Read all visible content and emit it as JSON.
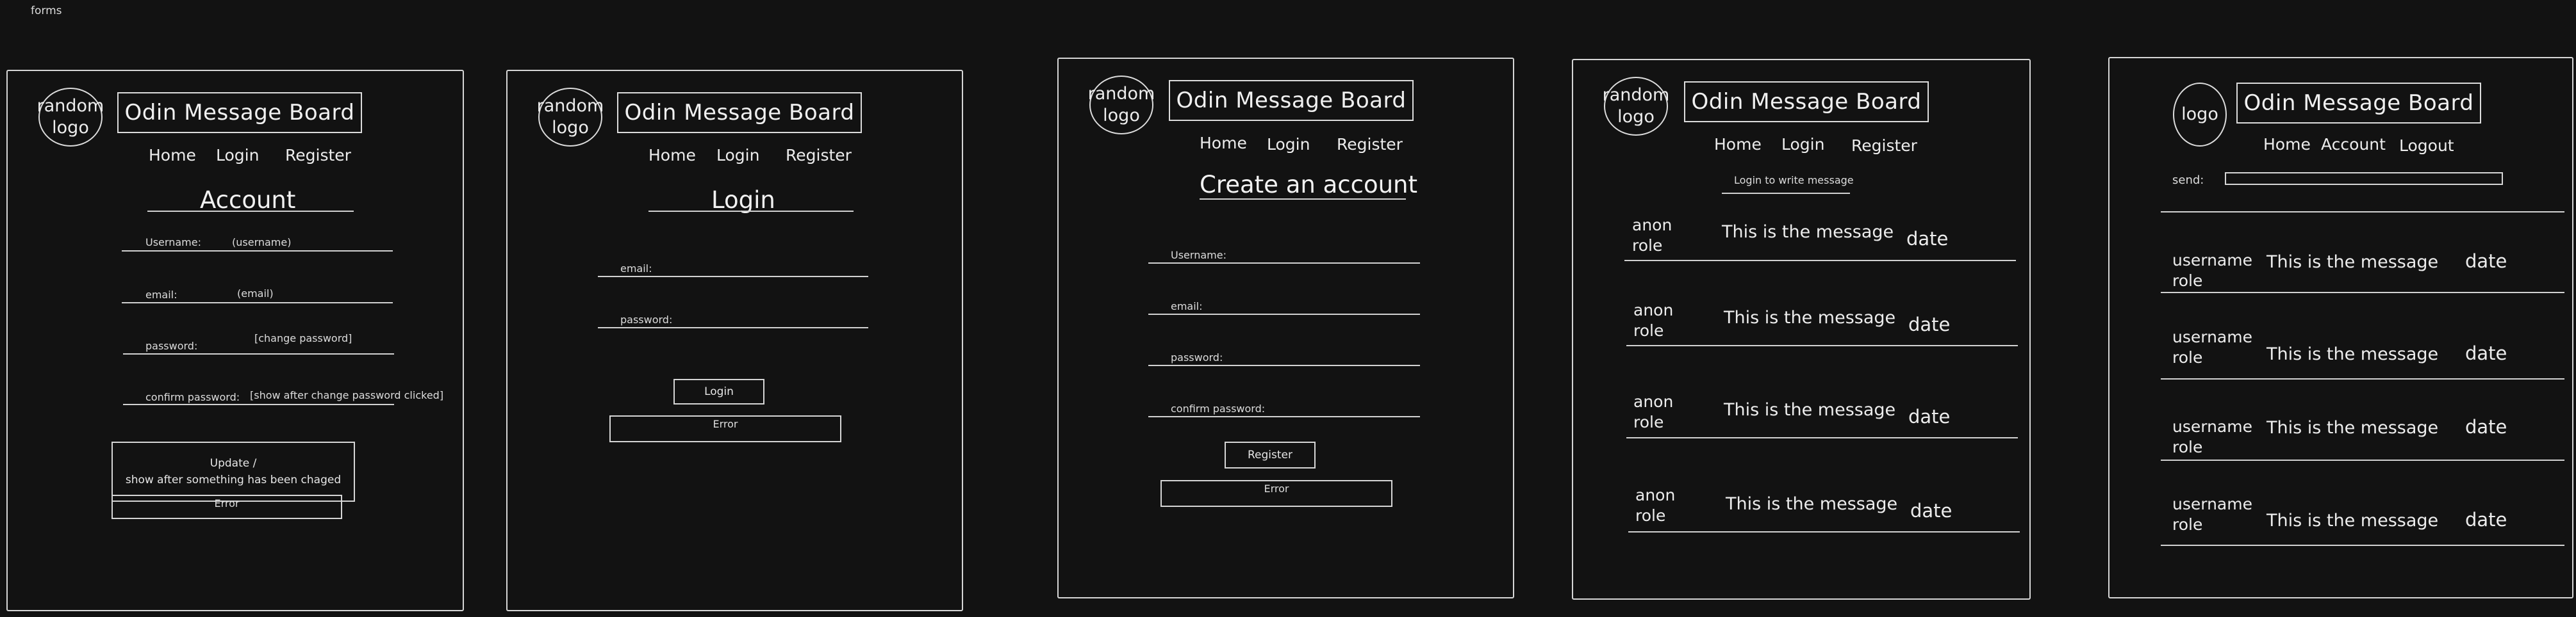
{
  "page_label": "forms",
  "shared": {
    "app_title": "Odin Message Board",
    "logo_text": "random\nlogo",
    "nav_home": "Home",
    "nav_login": "Login",
    "nav_register": "Register",
    "nav_account": "Account",
    "nav_logout": "Logout",
    "error_label": "Error"
  },
  "account": {
    "heading": "Account",
    "username_label": "Username:",
    "username_value": "(username)",
    "email_label": "email:",
    "email_value": "(email)",
    "password_label": "password:",
    "password_note": "[change password]",
    "confirm_label": "confirm password:",
    "confirm_note": "[show after change password clicked]",
    "update_label": "Update /\nshow after something has been chaged"
  },
  "login": {
    "heading": "Login",
    "email_label": "email:",
    "password_label": "password:",
    "button_label": "Login"
  },
  "register": {
    "heading": "Create an account",
    "username_label": "Username:",
    "email_label": "email:",
    "password_label": "password:",
    "confirm_label": "confirm password:",
    "button_label": "Register"
  },
  "board_guest": {
    "login_prompt": "Login to write message",
    "messages": [
      {
        "user": "anon\nrole",
        "text": "This is the message",
        "date": "date"
      },
      {
        "user": "anon\nrole",
        "text": "This is the message",
        "date": "date"
      },
      {
        "user": "anon\nrole",
        "text": "This is the message",
        "date": "date"
      },
      {
        "user": "anon\nrole",
        "text": "This is the message",
        "date": "date"
      }
    ]
  },
  "board_member": {
    "logo_text": "logo",
    "send_label": "send:",
    "messages": [
      {
        "user": "username\nrole",
        "text": "This is the message",
        "date": "date"
      },
      {
        "user": "username\nrole",
        "text": "This is the message",
        "date": "date"
      },
      {
        "user": "username\nrole",
        "text": "This is the message",
        "date": "date"
      },
      {
        "user": "username\nrole",
        "text": "This is the message",
        "date": "date"
      }
    ]
  }
}
